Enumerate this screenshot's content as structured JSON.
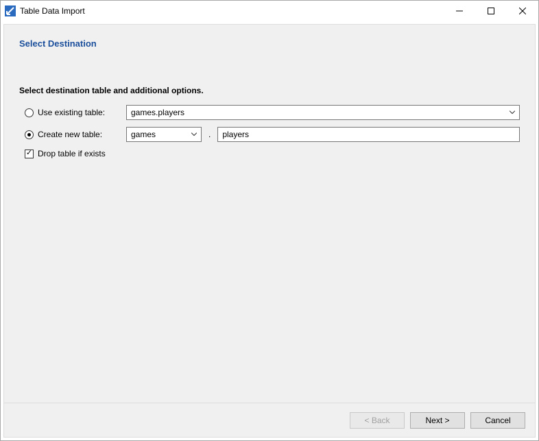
{
  "window": {
    "title": "Table Data Import"
  },
  "heading": "Select Destination",
  "instruction": "Select destination table and additional options.",
  "form": {
    "use_existing": {
      "label": "Use existing table:",
      "value": "games.players",
      "selected": false
    },
    "create_new": {
      "label": "Create new table:",
      "schema": "games",
      "table": "players",
      "selected": true
    },
    "drop_if_exists": {
      "label": "Drop table if exists",
      "checked": true
    },
    "separator": "."
  },
  "footer": {
    "back": "< Back",
    "next": "Next >",
    "cancel": "Cancel"
  }
}
